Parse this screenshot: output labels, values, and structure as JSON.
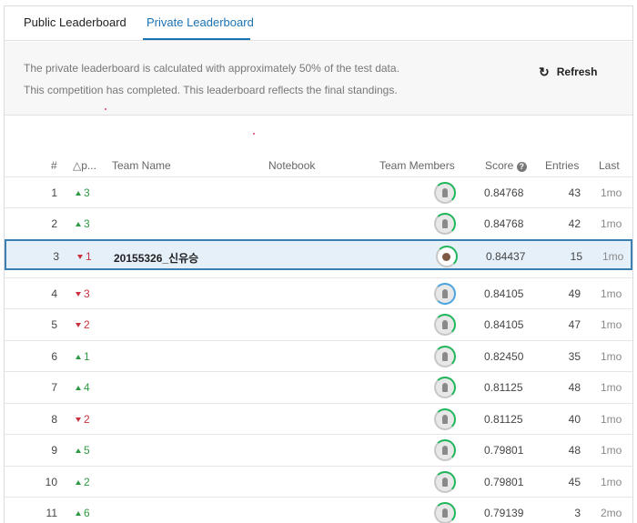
{
  "tabs": [
    {
      "label": "Public Leaderboard",
      "active": false
    },
    {
      "label": "Private Leaderboard",
      "active": true
    }
  ],
  "notice": {
    "line1": "The private leaderboard is calculated with approximately 50% of the test data.",
    "line2": "This competition has completed. This leaderboard reflects the final standings.",
    "refresh_label": "Refresh",
    "refresh_icon": "refresh-icon"
  },
  "table": {
    "headers": {
      "rank": "#",
      "delta": "△p...",
      "team": "Team Name",
      "notebook": "Notebook",
      "members": "Team Members",
      "score": "Score",
      "entries": "Entries",
      "last": "Last"
    },
    "rows": [
      {
        "rank": "1",
        "dir": "up",
        "delta": "3",
        "team": "",
        "score": "0.84768",
        "entries": "43",
        "last": "1mo"
      },
      {
        "rank": "2",
        "dir": "up",
        "delta": "3",
        "team": "",
        "score": "0.84768",
        "entries": "42",
        "last": "1mo"
      },
      {
        "rank": "3",
        "dir": "down",
        "delta": "1",
        "team": "20155326_신유승",
        "score": "0.84437",
        "entries": "15",
        "last": "1mo"
      },
      {
        "rank": "4",
        "dir": "down",
        "delta": "3",
        "team": "",
        "score": "0.84105",
        "entries": "49",
        "last": "1mo"
      },
      {
        "rank": "5",
        "dir": "down",
        "delta": "2",
        "team": "",
        "score": "0.84105",
        "entries": "47",
        "last": "1mo"
      },
      {
        "rank": "6",
        "dir": "up",
        "delta": "1",
        "team": "",
        "score": "0.82450",
        "entries": "35",
        "last": "1mo"
      },
      {
        "rank": "7",
        "dir": "up",
        "delta": "4",
        "team": "",
        "score": "0.81125",
        "entries": "48",
        "last": "1mo"
      },
      {
        "rank": "8",
        "dir": "down",
        "delta": "2",
        "team": "",
        "score": "0.81125",
        "entries": "40",
        "last": "1mo"
      },
      {
        "rank": "9",
        "dir": "up",
        "delta": "5",
        "team": "",
        "score": "0.79801",
        "entries": "48",
        "last": "1mo"
      },
      {
        "rank": "10",
        "dir": "up",
        "delta": "2",
        "team": "",
        "score": "0.79801",
        "entries": "45",
        "last": "1mo"
      },
      {
        "rank": "11",
        "dir": "up",
        "delta": "6",
        "team": "",
        "score": "0.79139",
        "entries": "3",
        "last": "2mo"
      }
    ]
  },
  "colors": {
    "accent": "#1a73b5",
    "up": "#2f9a43",
    "down": "#c9313f",
    "selected_row": "#e5f0f8"
  }
}
